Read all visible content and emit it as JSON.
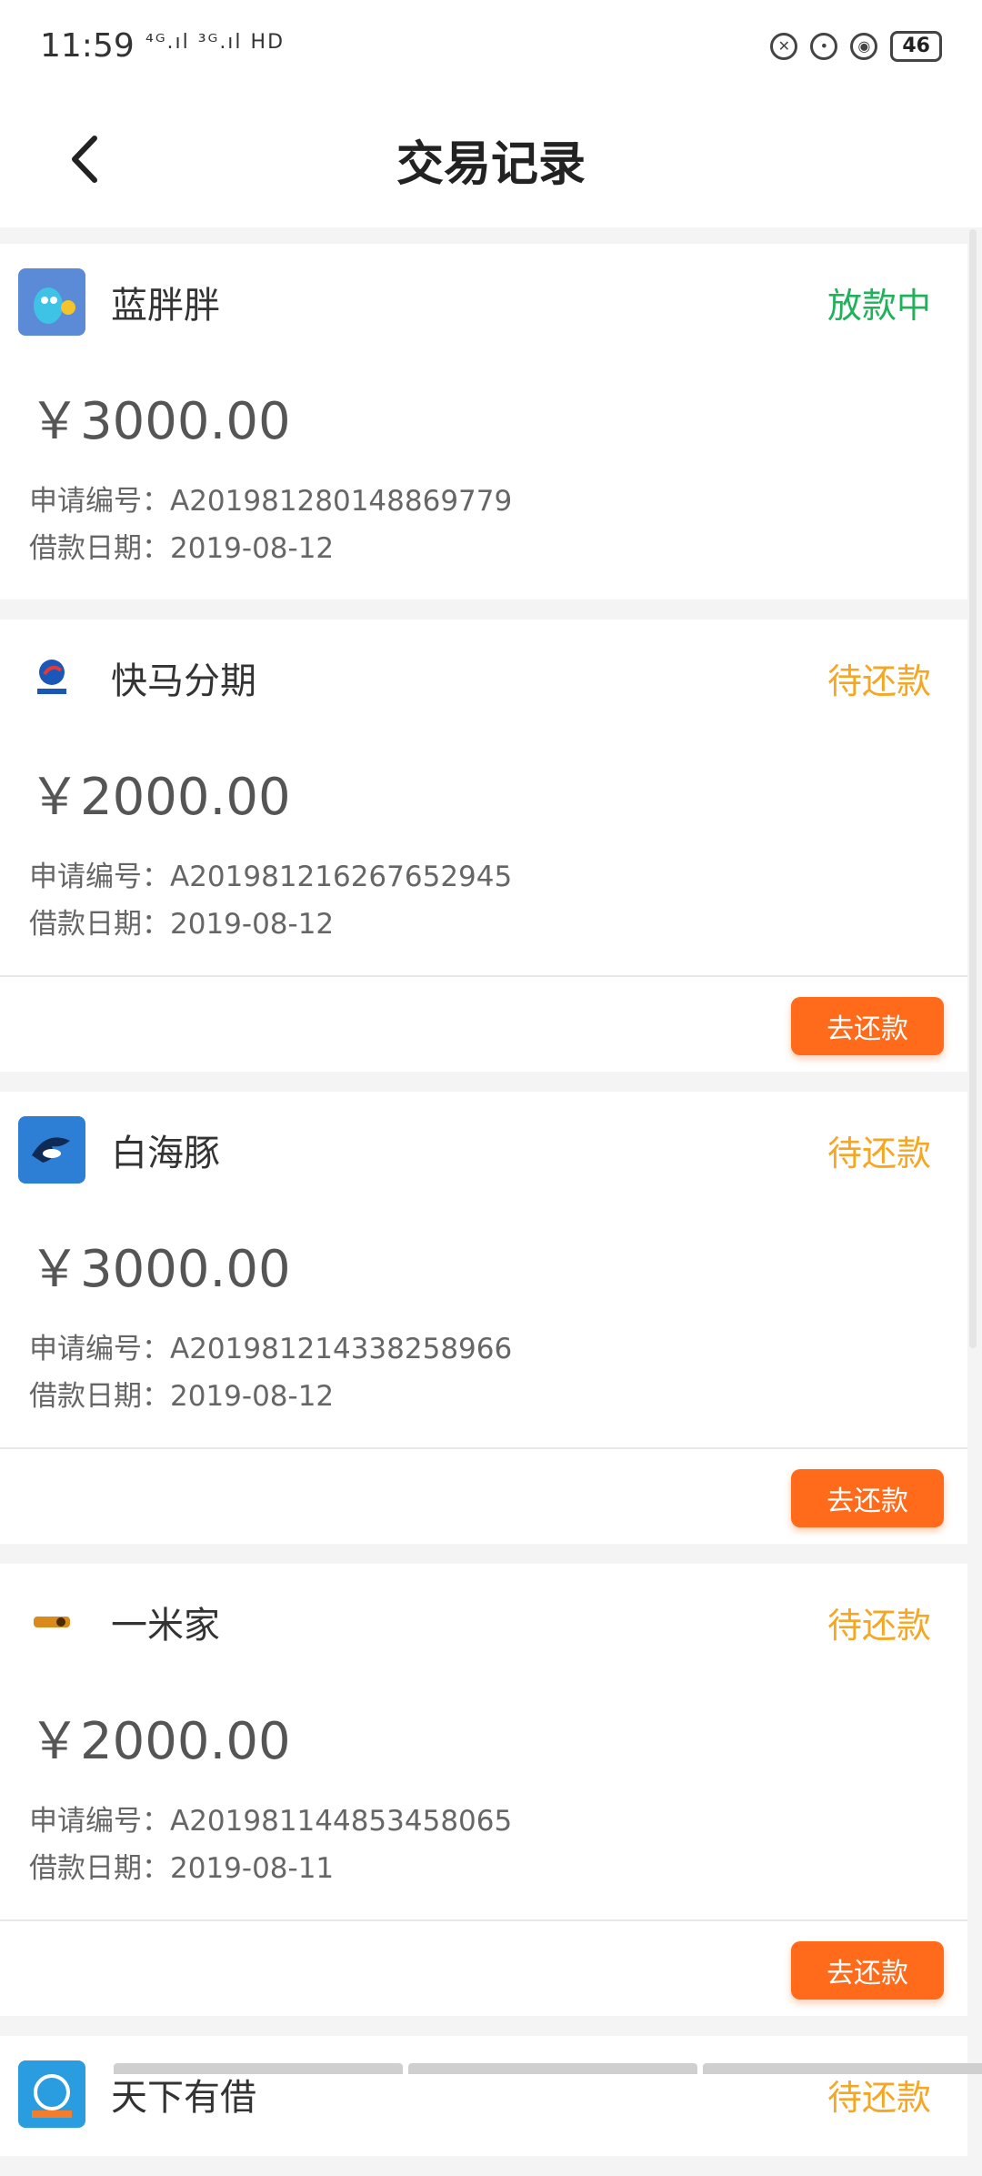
{
  "status_bar": {
    "time": "11:59",
    "signal": "⁴ᴳ.ıl ³ᴳ.ıl HD",
    "battery": "46"
  },
  "header": {
    "title": "交易记录"
  },
  "records": [
    {
      "name": "蓝胖胖",
      "status": "放款中",
      "status_color": "#1fb25a",
      "amount": "￥3000.00",
      "app_no": "申请编号：A201981280148869779",
      "date": "借款日期：2019-08-12",
      "logo_color": "#5b8ad6",
      "has_button": false
    },
    {
      "name": "快马分期",
      "status": "待还款",
      "status_color": "#f5a623",
      "amount": "￥2000.00",
      "app_no": "申请编号：A201981216267652945",
      "date": "借款日期：2019-08-12",
      "logo_color": "#1a57b8",
      "has_button": true,
      "button_label": "去还款"
    },
    {
      "name": "白海豚",
      "status": "待还款",
      "status_color": "#f5a623",
      "amount": "￥3000.00",
      "app_no": "申请编号：A201981214338258966",
      "date": "借款日期：2019-08-12",
      "logo_color": "#2d7fd6",
      "has_button": true,
      "button_label": "去还款"
    },
    {
      "name": "一米家",
      "status": "待还款",
      "status_color": "#f5a623",
      "amount": "￥2000.00",
      "app_no": "申请编号：A201981144853458065",
      "date": "借款日期：2019-08-11",
      "logo_color": "#d98a1a",
      "has_button": true,
      "button_label": "去还款"
    },
    {
      "name": "天下有借",
      "status": "待还款",
      "status_color": "#f5a623",
      "logo_color": "#2a9de0"
    }
  ]
}
